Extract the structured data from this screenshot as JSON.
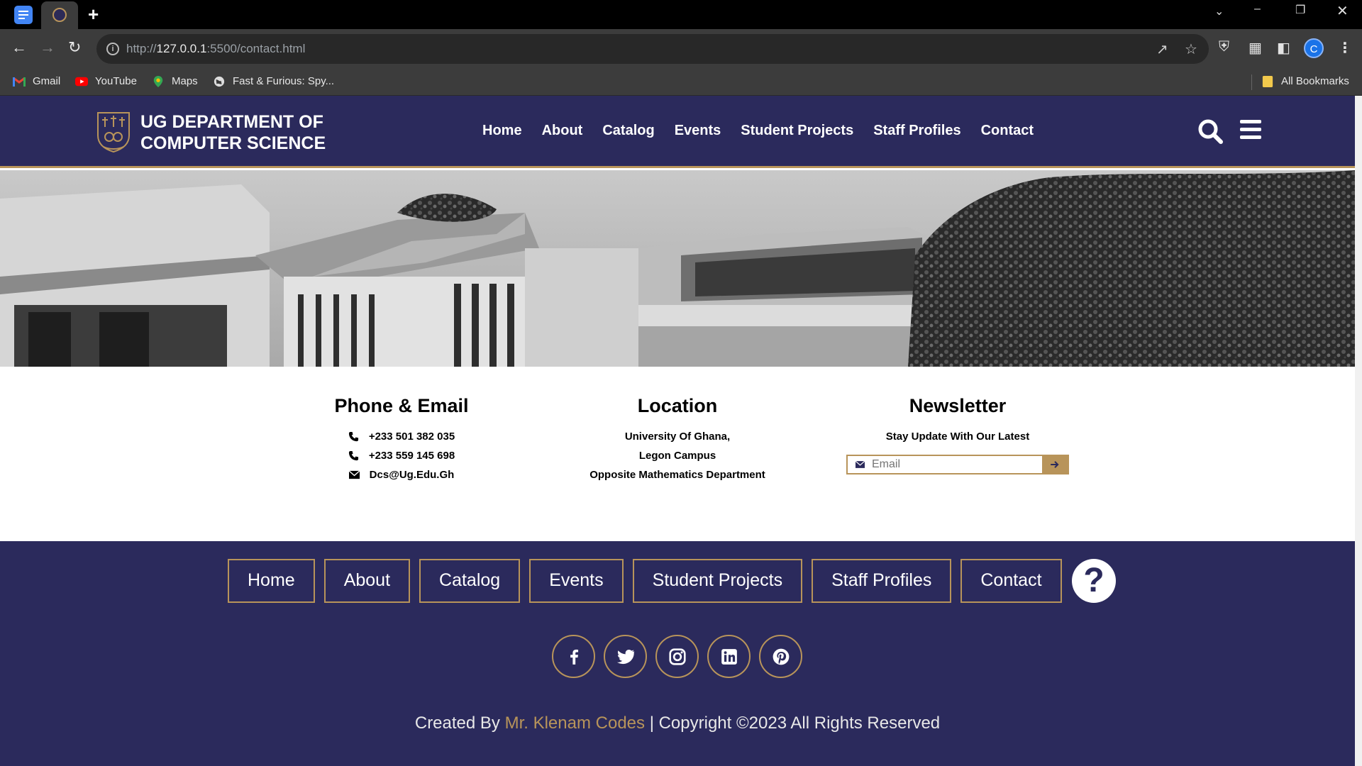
{
  "browser": {
    "url_host": "127.0.0.1",
    "url_rest": ":5500/contact.html",
    "url_prefix": "http://",
    "profile_initial": "C",
    "bookmarks": [
      {
        "label": "Gmail",
        "icon": "gmail-icon"
      },
      {
        "label": "YouTube",
        "icon": "youtube-icon"
      },
      {
        "label": "Maps",
        "icon": "maps-icon"
      },
      {
        "label": "Fast & Furious: Spy...",
        "icon": "globe-icon"
      }
    ],
    "all_bookmarks": "All Bookmarks"
  },
  "header": {
    "brand_line1": "UG DEPARTMENT OF",
    "brand_line2": "COMPUTER SCIENCE",
    "nav": [
      "Home",
      "About",
      "Catalog",
      "Events",
      "Student Projects",
      "Staff Profiles",
      "Contact"
    ]
  },
  "contact": {
    "phone_email": {
      "title": "Phone & Email",
      "phone1": "+233 501 382 035",
      "phone2": "+233 559 145 698",
      "email": "Dcs@Ug.Edu.Gh"
    },
    "location": {
      "title": "Location",
      "line1": "University Of Ghana,",
      "line2": "Legon Campus",
      "line3": "Opposite Mathematics Department"
    },
    "newsletter": {
      "title": "Newsletter",
      "subtitle": "Stay Update With Our Latest",
      "placeholder": "Email"
    }
  },
  "footer": {
    "nav": [
      "Home",
      "About",
      "Catalog",
      "Events",
      "Student Projects",
      "Staff Profiles",
      "Contact"
    ],
    "help_glyph": "?",
    "socials": [
      "facebook-icon",
      "twitter-icon",
      "instagram-icon",
      "linkedin-icon",
      "pinterest-icon"
    ],
    "created_by": "Created By",
    "author": "Mr. Klenam Codes",
    "copyright": "| Copyright ©2023 All Rights Reserved"
  },
  "colors": {
    "navy": "#2b2a5c",
    "gold": "#b8945a"
  }
}
